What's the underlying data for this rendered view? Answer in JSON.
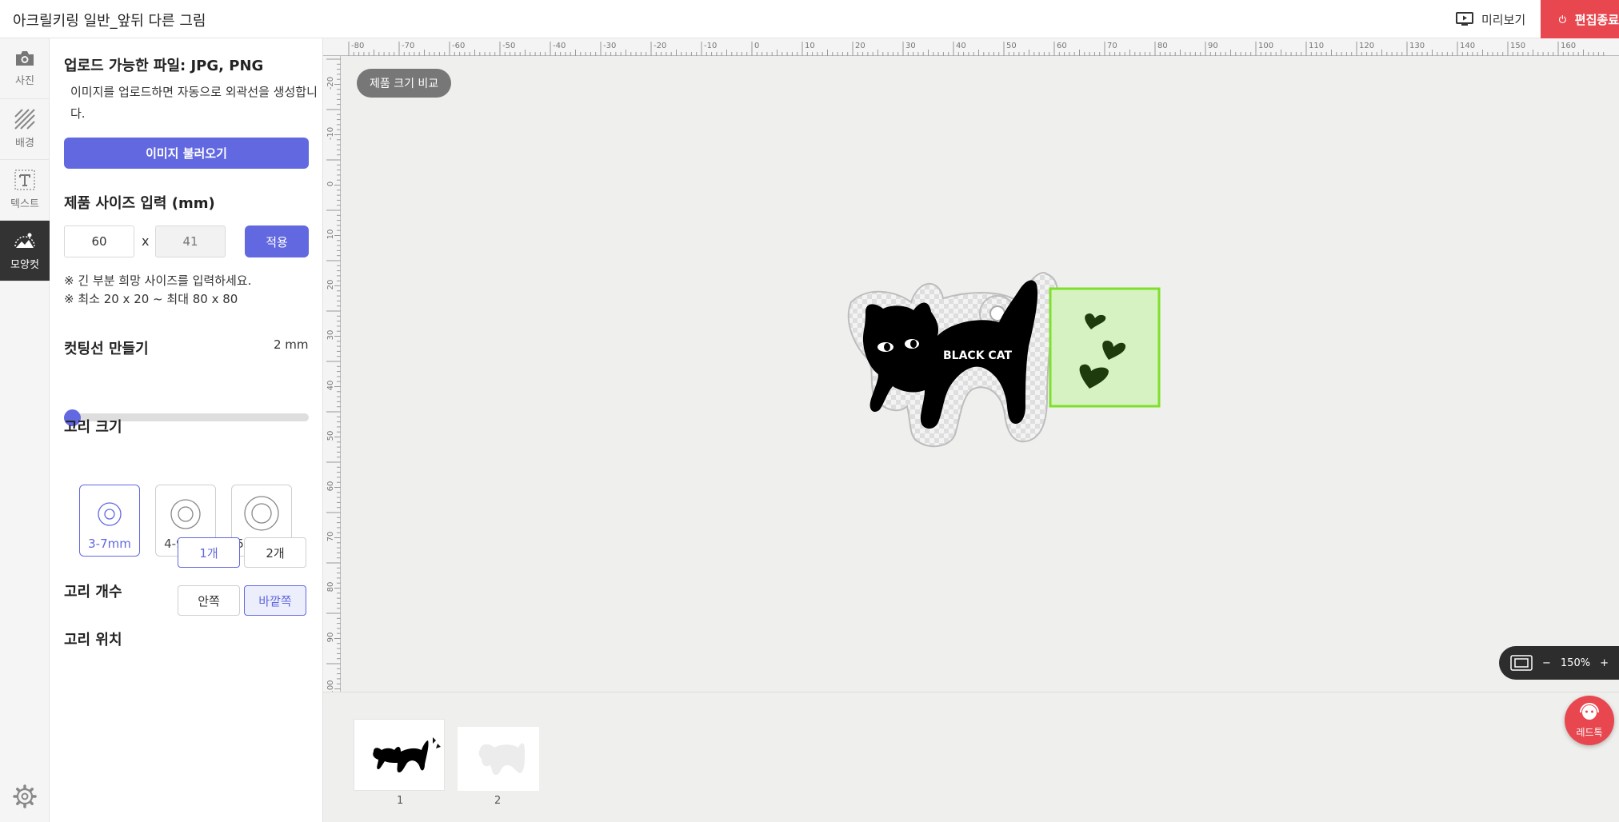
{
  "app": {
    "title": "아크릴키링 일반_앞뒤 다른 그림",
    "preview_label": "미리보기",
    "exit_label": "편집종료"
  },
  "rail": {
    "items": [
      {
        "label": "사진",
        "icon": "camera-icon"
      },
      {
        "label": "배경",
        "icon": "hatch-icon"
      },
      {
        "label": "텍스트",
        "icon": "text-icon"
      },
      {
        "label": "모양컷",
        "icon": "shape-cut-icon",
        "active": true
      }
    ],
    "settings_icon": "gear-icon"
  },
  "panel": {
    "upload_title": "업로드 가능한 파일: JPG, PNG",
    "upload_desc": "이미지를 업로드하면 자동으로 외곽선을 생성합니다.",
    "load_button": "이미지 불러오기",
    "size_title": "제품 사이즈 입력 (mm)",
    "width_value": "60",
    "height_value": "41",
    "size_x": "x",
    "apply_button": "적용",
    "note_1": "※ 긴 부분 희망 사이즈를 입력하세요.",
    "note_2": "※ 최소 20 x 20 ~ 최대 80 x 80",
    "cutline_title": "컷팅선 만들기",
    "cutline_value": "2 mm",
    "cutline_level": 0,
    "ring_size_title": "고리 크기",
    "ring_sizes": [
      "3-7mm",
      "4-9mm",
      "5-11mm"
    ],
    "ring_size_selected": "3-7mm",
    "ring_count_title": "고리 개수",
    "ring_counts": [
      "1개",
      "2개"
    ],
    "ring_count_selected": "1개",
    "ring_position_title": "고리 위치",
    "ring_positions": [
      "안쪽",
      "바깥쪽"
    ],
    "ring_position_selected": "바깥쪽"
  },
  "workspace": {
    "compare_button": "제품 크기 비교",
    "ruler_top_labels": [
      "-80",
      "-70",
      "-60",
      "-50",
      "-40",
      "-30",
      "-20",
      "-10",
      "0",
      "10",
      "20",
      "30",
      "40",
      "50",
      "60",
      "70",
      "80",
      "90",
      "100",
      "110",
      "120",
      "130",
      "140",
      "150",
      "160"
    ],
    "ruler_left_labels": [
      "-20",
      "-10",
      "0",
      "10",
      "20",
      "30",
      "40",
      "50",
      "60",
      "70",
      "80",
      "90",
      "100"
    ],
    "design_text": "BLACK CAT",
    "zoom_level": "150%",
    "zoom_minus": "−",
    "zoom_plus": "+"
  },
  "strip": {
    "pages": [
      "1",
      "2"
    ]
  },
  "chat": {
    "label": "레드톡"
  },
  "colors": {
    "accent": "#6268e0",
    "exit": "#e8474f",
    "selection": "#7ee02a",
    "canvas_bg": "#efefed"
  }
}
